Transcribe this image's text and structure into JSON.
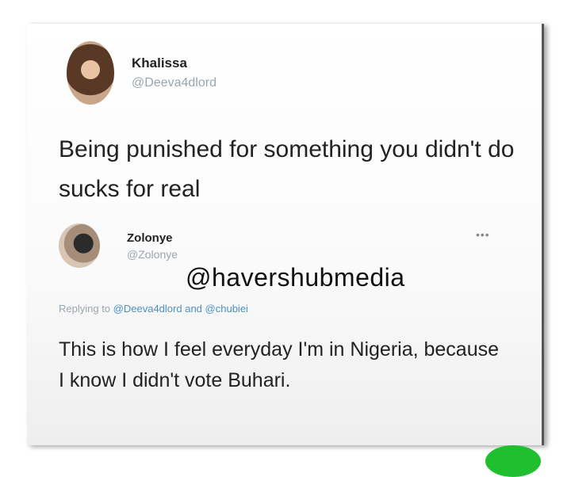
{
  "original_tweet": {
    "name": "Khalissa",
    "handle": "@Deeva4dlord",
    "text": "Being punished for something you didn't do sucks for real"
  },
  "reply": {
    "name": "Zolonye",
    "handle": "@Zolonye",
    "more": "•••",
    "replying_prefix": "Replying to",
    "replying_to_1": "@Deeva4dlord",
    "replying_joiner": "and",
    "replying_to_2": "@chubiei",
    "text": "This is how I feel everyday I'm in Nigeria, because I know I didn't vote Buhari."
  },
  "watermark": "@havershubmedia",
  "colors": {
    "link": "#4a90c6",
    "handle": "#9aa5ad",
    "badge": "#1fbf2e"
  }
}
